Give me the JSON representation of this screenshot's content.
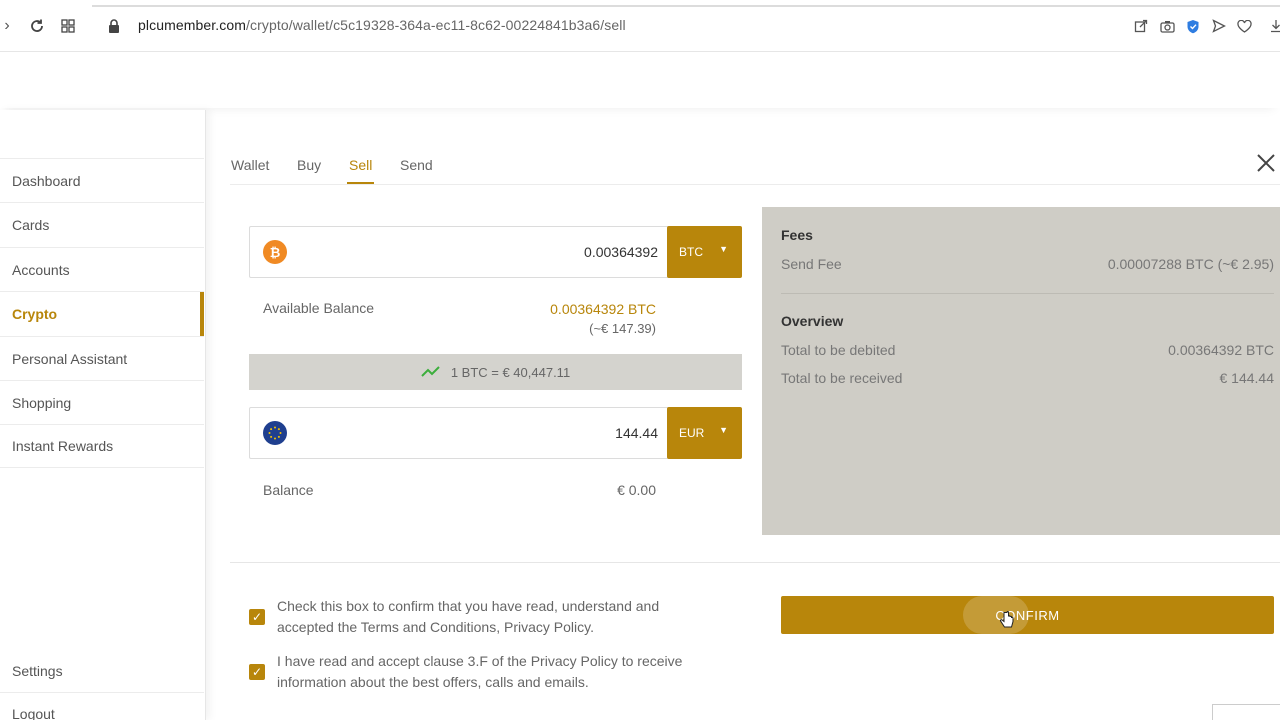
{
  "browser": {
    "url_host": "plcumember.com",
    "url_path": "/crypto/wallet/c5c19328-364a-ec11-8c62-00224841b3a6/sell"
  },
  "sidebar": {
    "items": [
      {
        "label": "Dashboard"
      },
      {
        "label": "Cards"
      },
      {
        "label": "Accounts"
      },
      {
        "label": "Crypto"
      },
      {
        "label": "Personal Assistant"
      },
      {
        "label": "Shopping"
      },
      {
        "label": "Instant Rewards"
      }
    ],
    "settings_label": "Settings",
    "logout_label": "Logout"
  },
  "tabs": [
    {
      "label": "Wallet"
    },
    {
      "label": "Buy"
    },
    {
      "label": "Sell"
    },
    {
      "label": "Send"
    }
  ],
  "sell_form": {
    "btc_amount": "0.00364392",
    "btc_currency": "BTC",
    "available_balance_label": "Available Balance",
    "available_balance_btc": "0.00364392 BTC",
    "available_balance_eur": "(~€ 147.39)",
    "rate_text": "1 BTC = € 40,447.11",
    "eur_amount": "144.44",
    "eur_currency": "EUR",
    "balance_label": "Balance",
    "balance_value": "€ 0.00"
  },
  "summary": {
    "fees_heading": "Fees",
    "send_fee_label": "Send Fee",
    "send_fee_value": "0.00007288 BTC (~€ 2.95)",
    "overview_heading": "Overview",
    "debited_label": "Total to be debited",
    "debited_value": "0.00364392 BTC",
    "received_label": "Total to be received",
    "received_value": "€ 144.44"
  },
  "consent": {
    "terms_text": "Check this box to confirm that you have read, understand and accepted the Terms and Conditions, Privacy Policy.",
    "privacy_text": "I have read and accept clause 3.F of the Privacy Policy to receive information about the best offers, calls and emails."
  },
  "confirm_label": "CONFIRM",
  "colors": {
    "accent": "#b8860b",
    "summary_bg": "#cfcdc6",
    "rate_bg": "#d4d3ce",
    "trend_green": "#3cae3c"
  }
}
